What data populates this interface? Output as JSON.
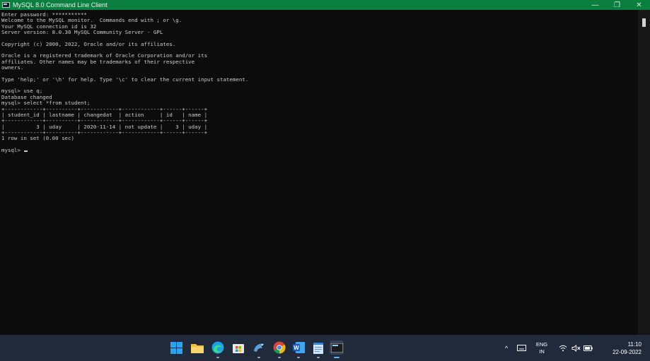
{
  "window": {
    "title": "MySQL 8.0 Command Line Client",
    "icon": "console-app-icon",
    "controls": {
      "minimize": "—",
      "restore": "❐",
      "close": "✕"
    }
  },
  "console": {
    "lines": [
      "Enter password: ***********",
      "Welcome to the MySQL monitor.  Commands end with ; or \\g.",
      "Your MySQL connection id is 32",
      "Server version: 8.0.30 MySQL Community Server - GPL",
      "",
      "Copyright (c) 2000, 2022, Oracle and/or its affiliates.",
      "",
      "Oracle is a registered trademark of Oracle Corporation and/or its",
      "affiliates. Other names may be trademarks of their respective",
      "owners.",
      "",
      "Type 'help;' or '\\h' for help. Type '\\c' to clear the current input statement.",
      "",
      "mysql> use q;",
      "Database changed",
      "mysql> select *from student;",
      "+------------+----------+------------+------------+------+------+",
      "| student_id | lastname | changedat  | action     | id   | name |",
      "+------------+----------+------------+------------+------+------+",
      "|          3 | uday     | 2020-11-14 | not update |    3 | uday |",
      "+------------+----------+------------+------------+------+------+",
      "1 row in set (0.00 sec)",
      ""
    ],
    "prompt": "mysql> "
  },
  "result_table": {
    "columns": [
      "student_id",
      "lastname",
      "changedat",
      "action",
      "id",
      "name"
    ],
    "rows": [
      [
        "3",
        "uday",
        "2020-11-14",
        "not update",
        "3",
        "uday"
      ]
    ]
  },
  "taskbar": {
    "apps": [
      {
        "name": "start-button",
        "icon": "windows-logo-icon",
        "running": false
      },
      {
        "name": "file-explorer",
        "icon": "folder-icon",
        "running": false
      },
      {
        "name": "edge-browser",
        "icon": "edge-icon",
        "running": true
      },
      {
        "name": "microsoft-store",
        "icon": "store-icon",
        "running": false
      },
      {
        "name": "mysql-workbench",
        "icon": "dolphin-icon",
        "running": true
      },
      {
        "name": "chrome-browser",
        "icon": "chrome-icon",
        "running": true
      },
      {
        "name": "word",
        "icon": "word-icon",
        "running": true
      },
      {
        "name": "notepad",
        "icon": "notepad-icon",
        "running": true
      },
      {
        "name": "mysql-command-line-client",
        "icon": "console-app-icon",
        "running": true
      }
    ],
    "tray": {
      "chevron": "^",
      "keyboard_icon": "keyboard-icon",
      "language": "ENG",
      "region": "IN",
      "wifi_icon": "wifi-icon",
      "volume_icon": "volume-muted-icon",
      "battery_icon": "battery-icon",
      "time": "11:10",
      "date": "22-09-2022"
    }
  },
  "colors": {
    "titlebar": "#0a7f3f",
    "console_bg": "#0c0c0c",
    "console_text": "#cccccc",
    "taskbar": "#202a3a"
  }
}
